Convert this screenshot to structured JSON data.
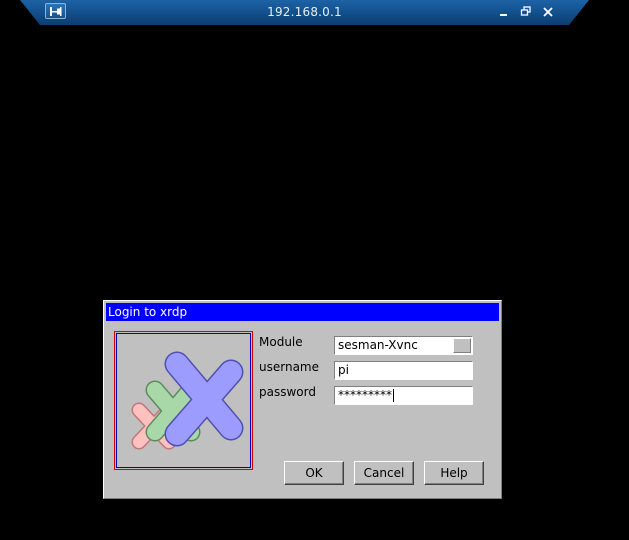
{
  "connection_bar": {
    "title": "192.168.0.1",
    "icons": [
      "pin-icon",
      "minimize-icon",
      "restore-icon",
      "close-icon"
    ]
  },
  "dialog": {
    "title": "Login to xrdp",
    "logo": "xrdp-logo",
    "fields": {
      "module": {
        "label": "Module",
        "value": "sesman-Xvnc"
      },
      "username": {
        "label": "username",
        "value": "pi"
      },
      "password": {
        "label": "password",
        "value": "*********"
      }
    },
    "buttons": {
      "ok": "OK",
      "cancel": "Cancel",
      "help": "Help"
    }
  },
  "colors": {
    "desktop_bg": "#000000",
    "dialog_bg": "#c0c0c0",
    "title_bar": "#0000ff",
    "rd_bar": "#124e8a"
  }
}
